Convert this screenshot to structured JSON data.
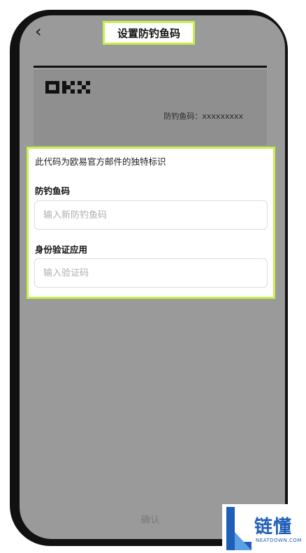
{
  "header": {
    "back_icon": "chevron-left-icon",
    "back_glyph": "‹",
    "title": "设置防钓鱼码"
  },
  "preview": {
    "brand": "OKX",
    "code_text": "防钓鱼码：xxxxxxxxx"
  },
  "form": {
    "intro": "此代码为欧易官方邮件的独特标识",
    "anti_phishing_label": "防钓鱼码",
    "anti_phishing_placeholder": "输入新防钓鱼码",
    "anti_phishing_value": "",
    "auth_label": "身份验证应用",
    "auth_placeholder": "输入验证码",
    "auth_value": ""
  },
  "footer": {
    "confirm_label": "确认"
  },
  "watermark": {
    "chinese": "链懂",
    "english": "NEATDOWN.COM"
  },
  "colors": {
    "highlight": "#c8ef4a",
    "overlay": "#9a9a9a",
    "watermark_blue": "#1f5fb8"
  }
}
